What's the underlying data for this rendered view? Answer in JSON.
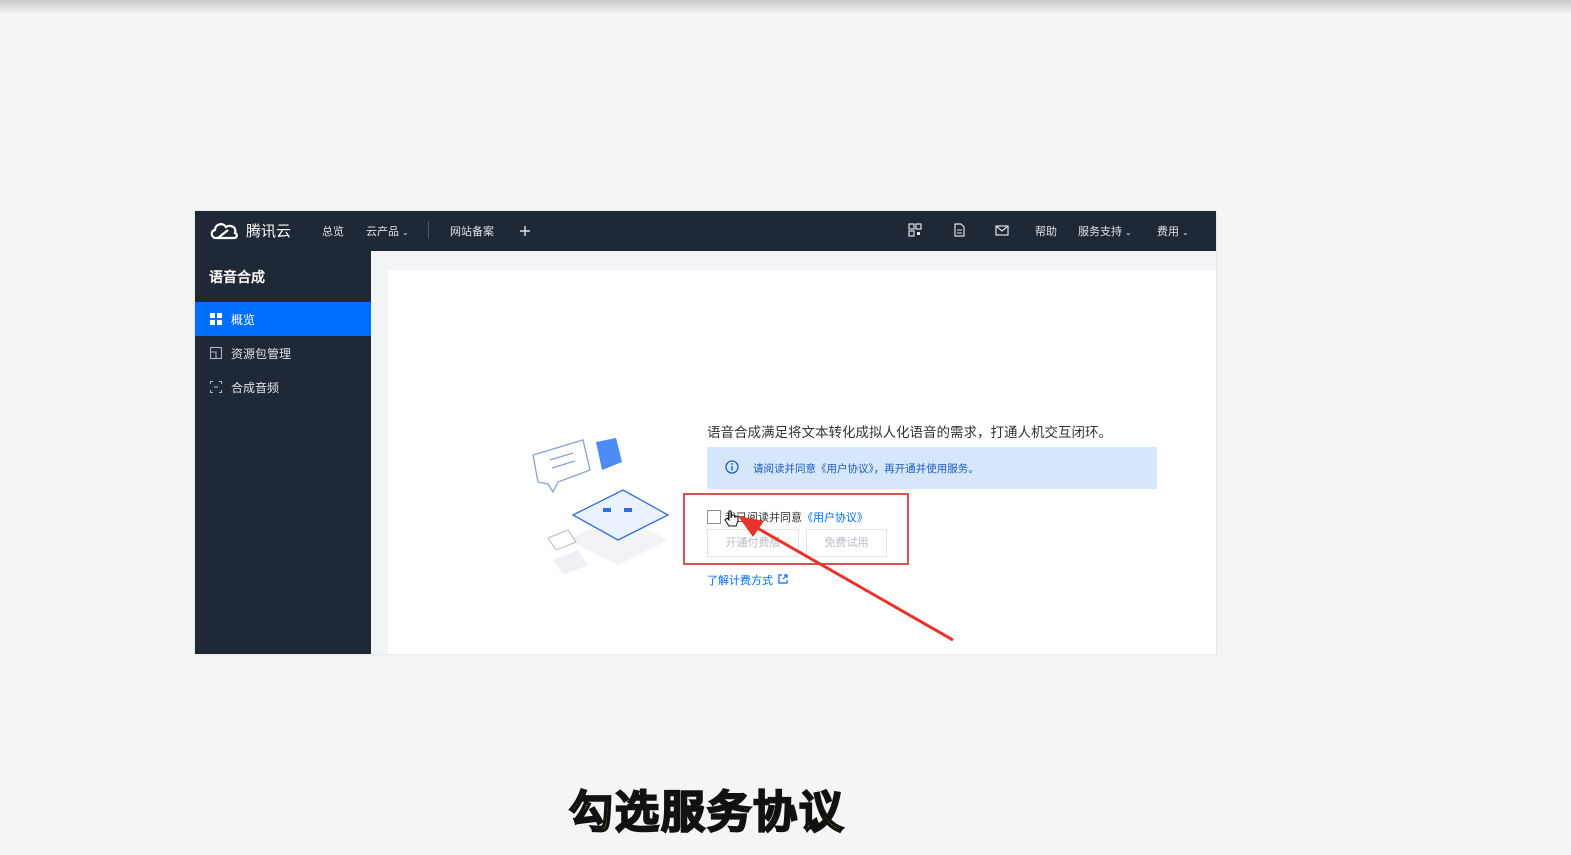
{
  "topnav": {
    "brand": "腾讯云",
    "overview": "总览",
    "products": "云产品",
    "filing": "网站备案",
    "add_icon": "plus-icon",
    "help": "帮助",
    "support": "服务支持",
    "billing": "费用"
  },
  "sidebar": {
    "title": "语音合成",
    "items": [
      {
        "label": "概览",
        "icon": "grid-icon"
      },
      {
        "label": "资源包管理",
        "icon": "package-icon"
      },
      {
        "label": "合成音频",
        "icon": "scan-icon"
      }
    ]
  },
  "main": {
    "description": "语音合成满足将文本转化成拟人化语音的需求，打通人机交互闭环。",
    "notice": "请阅读并同意《用户协议》，再开通并使用服务。",
    "agree_prefix": "我已阅读并同意",
    "agree_link": "《用户协议》",
    "btn_paid": "开通付费版",
    "btn_trial": "免费试用",
    "billing_link": "了解计费方式"
  },
  "caption": "勾选服务协议",
  "colors": {
    "nav_bg": "#1f2835",
    "active_blue": "#006eff",
    "annotation_red": "#d9534f",
    "caption_yellow": "#f6c400"
  }
}
